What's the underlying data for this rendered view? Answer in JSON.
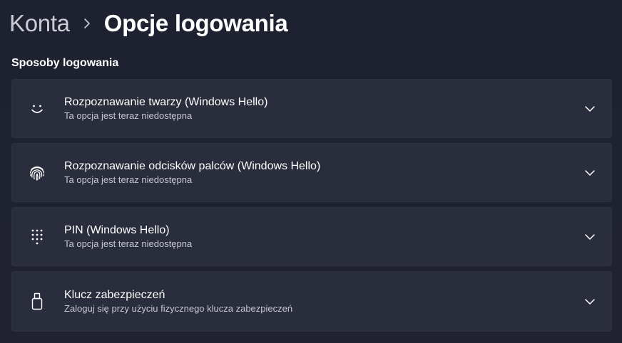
{
  "header": {
    "parent": "Konta",
    "current": "Opcje logowania"
  },
  "section": {
    "title": "Sposoby logowania"
  },
  "methods": [
    {
      "icon": "face-recognition-icon",
      "title": "Rozpoznawanie twarzy (Windows Hello)",
      "subtitle": "Ta opcja jest teraz niedostępna"
    },
    {
      "icon": "fingerprint-icon",
      "title": "Rozpoznawanie odcisków palców (Windows Hello)",
      "subtitle": "Ta opcja jest teraz niedostępna"
    },
    {
      "icon": "pin-keypad-icon",
      "title": "PIN (Windows Hello)",
      "subtitle": "Ta opcja jest teraz niedostępna"
    },
    {
      "icon": "security-key-icon",
      "title": "Klucz zabezpieczeń",
      "subtitle": "Zaloguj się przy użyciu fizycznego klucza zabezpieczeń"
    }
  ],
  "colors": {
    "background": "#1f2230",
    "card": "#2a2d3b",
    "text_primary": "#ffffff",
    "text_secondary": "#c5c8d0"
  }
}
